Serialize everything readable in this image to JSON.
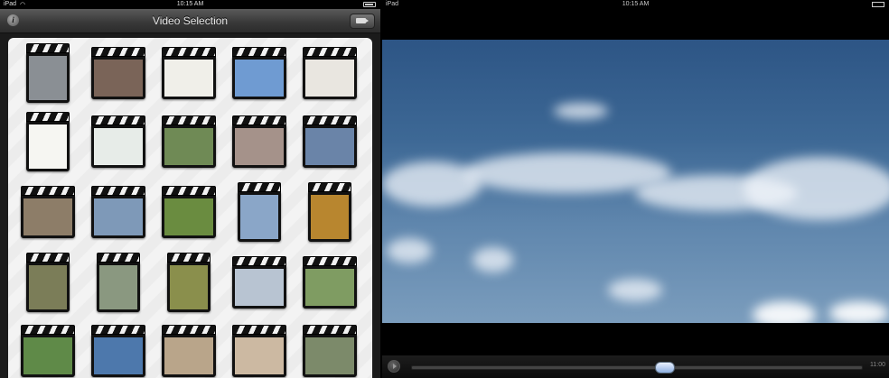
{
  "left": {
    "status": {
      "carrier": "iPad",
      "time": "10:15 AM"
    },
    "nav": {
      "title": "Video Selection",
      "info_icon": "info-icon",
      "mode_icon": "video-mode-icon"
    },
    "clips": [
      {
        "thumb": "#8a8f94"
      },
      {
        "thumb": "#7a6458"
      },
      {
        "thumb": "#f0efe9"
      },
      {
        "thumb": "#6f9bd2"
      },
      {
        "thumb": "#e9e6e0"
      },
      {
        "thumb": "#f6f6f2"
      },
      {
        "thumb": "#e7ece8"
      },
      {
        "thumb": "#6f8a55"
      },
      {
        "thumb": "#a5928a"
      },
      {
        "thumb": "#6a84a8"
      },
      {
        "thumb": "#8d7d68"
      },
      {
        "thumb": "#7e99b8"
      },
      {
        "thumb": "#6a8c40"
      },
      {
        "thumb": "#8aa6c8"
      },
      {
        "thumb": "#b8862f"
      },
      {
        "thumb": "#7b7d58"
      },
      {
        "thumb": "#8a9880"
      },
      {
        "thumb": "#8a8f4c"
      },
      {
        "thumb": "#b8c4d2"
      },
      {
        "thumb": "#7f9c62"
      },
      {
        "thumb": "#5f8a48"
      },
      {
        "thumb": "#4d78ac"
      },
      {
        "thumb": "#b9a58a"
      },
      {
        "thumb": "#ccb9a2"
      },
      {
        "thumb": "#7c8a6a"
      }
    ]
  },
  "right": {
    "status": {
      "carrier": "iPad",
      "time": "10:15 AM"
    },
    "player": {
      "play_icon": "play-icon",
      "duration": "11:00",
      "progress": 0.56
    }
  }
}
